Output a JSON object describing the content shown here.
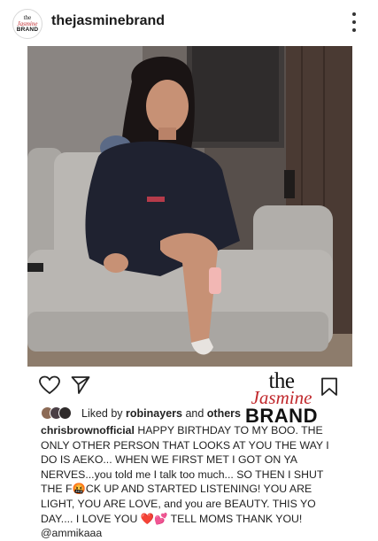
{
  "header": {
    "username": "thejasminebrand",
    "avatar": {
      "line1": "the",
      "line2": "Jasmine",
      "line3": "BRAND"
    }
  },
  "photo": {
    "icon": "photo-of-woman-on-sofa",
    "colors": {
      "wall": "#6e6763",
      "sofa": "#b9b6b2",
      "hoodie": "#1f2230",
      "skin": "#c79175"
    }
  },
  "watermark": {
    "line1": "the",
    "line2": "Jasmine",
    "line3": "BRAND"
  },
  "likes": {
    "prefix": "Liked by",
    "user": "robinayers",
    "middle": "and",
    "others": "others"
  },
  "caption": {
    "author": "chrisbrownofficial",
    "text_main": "HAPPY BIRTHDAY TO MY BOO. THE ONLY OTHER PERSON THAT LOOKS AT YOU THE WAY I DO IS AEKO... WHEN WE FIRST MET I GOT ON YA NERVES...you told me I talk too much... SO THEN I SHUT THE F🤬CK UP AND STARTED LISTENING! YOU ARE LIGHT, YOU ARE LOVE, and you are BEAUTY.  THIS YO DAY.... I LOVE YOU",
    "emoji_heart": "❤️",
    "emoji_hearts": "💕",
    "text_end": "TELL MOMS THANK YOU! @ammikaaa"
  },
  "colors": {
    "brand_red": "#c0282c",
    "text": "#222222"
  }
}
